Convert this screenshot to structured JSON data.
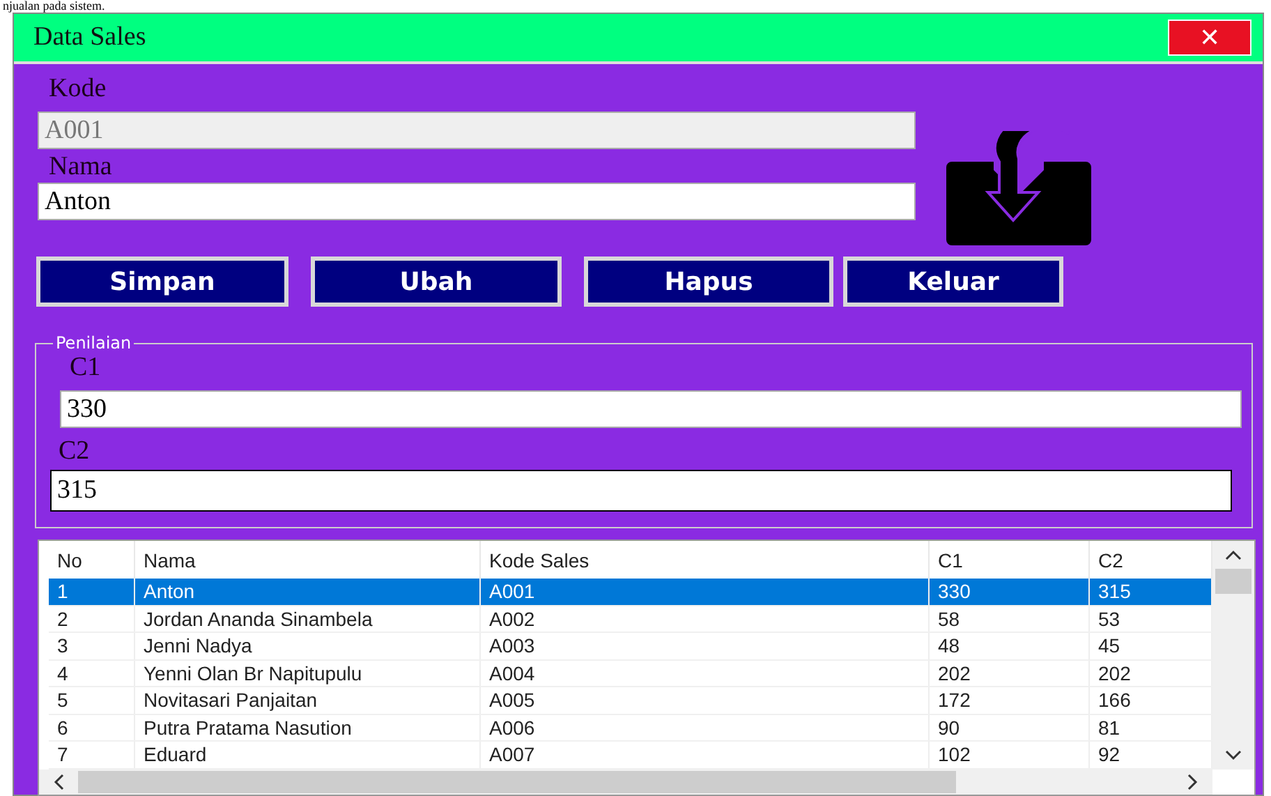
{
  "caption": "njualan pada sistem.",
  "window": {
    "title": "Data Sales",
    "close": "✕"
  },
  "form": {
    "kode_label": "Kode",
    "kode_value": "A001",
    "kode_disabled": true,
    "nama_label": "Nama",
    "nama_value": "Anton"
  },
  "buttons": [
    "Simpan",
    "Ubah",
    "Hapus",
    "Keluar"
  ],
  "penilaian": {
    "title": "Penilaian",
    "c1_label": "C1",
    "c1_value": "330",
    "c2_label": "C2",
    "c2_value": "315"
  },
  "table": {
    "columns": [
      "No",
      "Nama",
      "Kode Sales",
      "C1",
      "C2"
    ],
    "rows": [
      {
        "cells": [
          "1",
          "Anton",
          "A001",
          "330",
          "315"
        ],
        "selected": true
      },
      {
        "cells": [
          "2",
          "Jordan Ananda Sinambela",
          "A002",
          "58",
          "53"
        ],
        "selected": false
      },
      {
        "cells": [
          "3",
          "Jenni Nadya",
          "A003",
          "48",
          "45"
        ],
        "selected": false
      },
      {
        "cells": [
          "4",
          "Yenni Olan Br Napitupulu",
          "A004",
          "202",
          "202"
        ],
        "selected": false
      },
      {
        "cells": [
          "5",
          "Novitasari Panjaitan",
          "A005",
          "172",
          "166"
        ],
        "selected": false
      },
      {
        "cells": [
          "6",
          "Putra Pratama Nasution",
          "A006",
          "90",
          "81"
        ],
        "selected": false
      },
      {
        "cells": [
          "7",
          "Eduard",
          "A007",
          "102",
          "92"
        ],
        "selected": false
      }
    ]
  }
}
